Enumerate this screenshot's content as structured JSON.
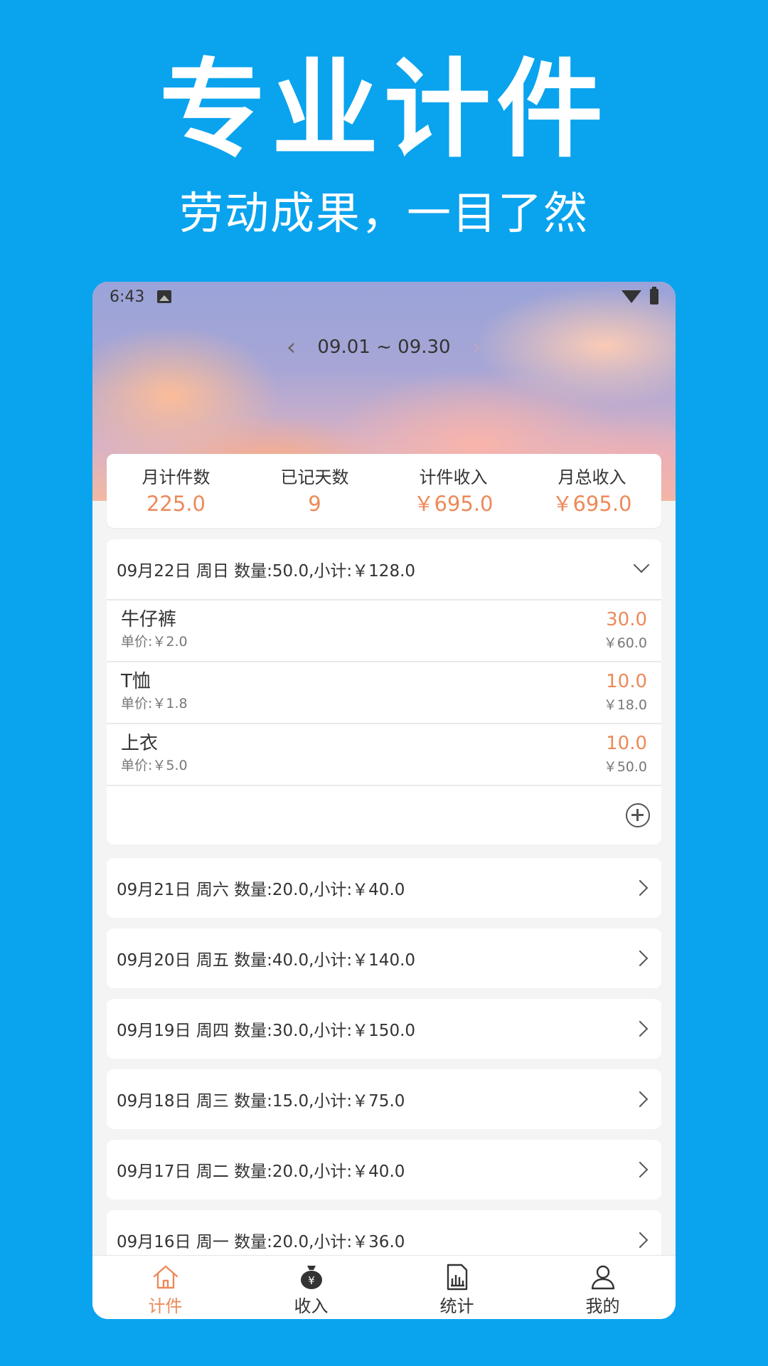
{
  "promo": {
    "title": "专业计件",
    "subtitle": "劳动成果，一目了然"
  },
  "status_bar": {
    "time": "6:43"
  },
  "date_nav": {
    "prev": "‹",
    "range": "09.01 ~ 09.30",
    "next": "›"
  },
  "summary": [
    {
      "label": "月计件数",
      "value": "225.0"
    },
    {
      "label": "已记天数",
      "value": "9"
    },
    {
      "label": "计件收入",
      "value": "￥695.0"
    },
    {
      "label": "月总收入",
      "value": "￥695.0"
    }
  ],
  "expanded_day": {
    "header": "09月22日 周日 数量:50.0,小计:￥128.0",
    "items": [
      {
        "name": "牛仔裤",
        "price": "单价:￥2.0",
        "qty": "30.0",
        "total": "￥60.0"
      },
      {
        "name": "T恤",
        "price": "单价:￥1.8",
        "qty": "10.0",
        "total": "￥18.0"
      },
      {
        "name": "上衣",
        "price": "单价:￥5.0",
        "qty": "10.0",
        "total": "￥50.0"
      }
    ]
  },
  "days": [
    "09月21日 周六 数量:20.0,小计:￥40.0",
    "09月20日 周五 数量:40.0,小计:￥140.0",
    "09月19日 周四 数量:30.0,小计:￥150.0",
    "09月18日 周三 数量:15.0,小计:￥75.0",
    "09月17日 周二 数量:20.0,小计:￥40.0",
    "09月16日 周一 数量:20.0,小计:￥36.0"
  ],
  "bottom_nav": [
    {
      "label": "计件",
      "icon": "home-icon",
      "active": true
    },
    {
      "label": "收入",
      "icon": "money-bag-icon",
      "active": false
    },
    {
      "label": "统计",
      "icon": "stats-document-icon",
      "active": false
    },
    {
      "label": "我的",
      "icon": "user-icon",
      "active": false
    }
  ],
  "colors": {
    "background": "#0aa3ee",
    "accent": "#ec8a5a",
    "text": "#333333"
  }
}
